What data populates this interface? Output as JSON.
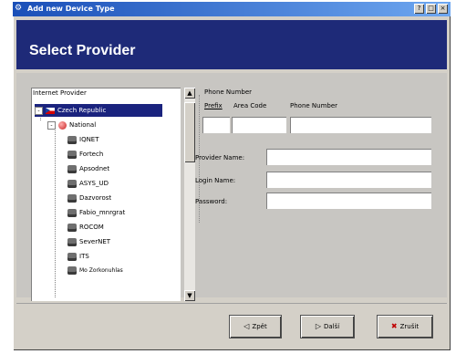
{
  "window": {
    "title": "Add new Device Type",
    "controls": [
      "?",
      "□",
      "×"
    ]
  },
  "header": {
    "title": "Select Provider"
  },
  "tree": {
    "header": "Internet Provider",
    "items": [
      {
        "label": "Czech Republic",
        "kind": "country",
        "selected": true
      },
      {
        "label": "National",
        "kind": "group",
        "expander": "-"
      },
      {
        "label": "IQNET",
        "kind": "provider"
      },
      {
        "label": "Fortech",
        "kind": "provider"
      },
      {
        "label": "Apsodnet",
        "kind": "provider"
      },
      {
        "label": "ASYS_UD",
        "kind": "provider"
      },
      {
        "label": "Dazvorost",
        "kind": "provider"
      },
      {
        "label": "Fabio_mnrgrat",
        "kind": "provider"
      },
      {
        "label": "ROCOM",
        "kind": "provider"
      },
      {
        "label": "SeverNET",
        "kind": "provider"
      },
      {
        "label": "ITS",
        "kind": "provider"
      },
      {
        "label": "Mo Zorkonuhlas",
        "kind": "provider"
      }
    ]
  },
  "scrollbar": {
    "up": "▲",
    "down": "▼"
  },
  "phone": {
    "group_label": "Phone Number",
    "prefix_label": "Prefix",
    "area_code_label": "Area Code",
    "number_label": "Phone Number",
    "prefix": "",
    "area_code": "",
    "number": ""
  },
  "form": {
    "provider_name_label": "Provider Name:",
    "login_name_label": "Login Name:",
    "password_label": "Password:",
    "provider_name": "",
    "login_name": "",
    "password": ""
  },
  "buttons": {
    "back": "Zpět",
    "next": "Další",
    "cancel": "Zrušit"
  }
}
